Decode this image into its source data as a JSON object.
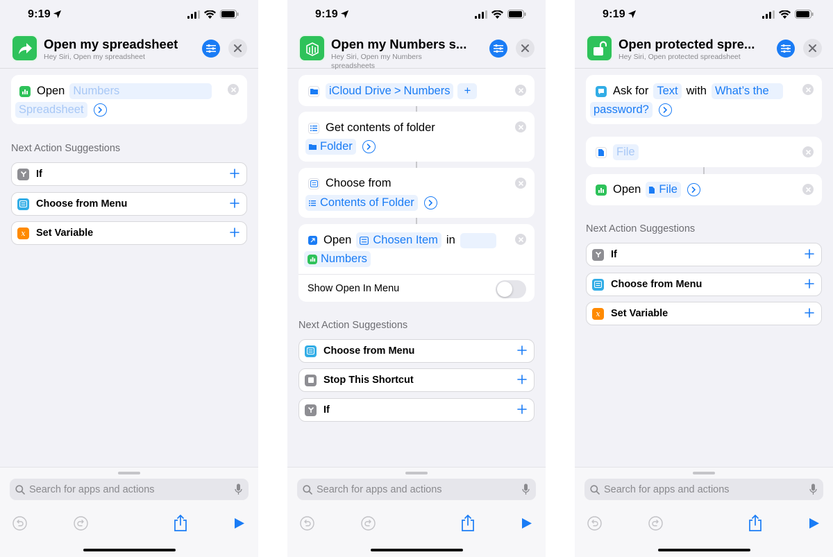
{
  "colors": {
    "accent": "#1a7cf5",
    "numbers_green": "#2ec25a",
    "background": "#f2f2f7"
  },
  "status": {
    "time": "9:19"
  },
  "bottom": {
    "search_placeholder": "Search for apps and actions"
  },
  "phones": [
    {
      "header": {
        "title": "Open my spreadsheet",
        "subtitle": "Hey Siri, Open my spreadsheet",
        "icon": "share-arrow-icon"
      },
      "action": {
        "verb": "Open",
        "token1": "Numbers",
        "token2": "Spreadsheet"
      },
      "suggestions_label": "Next Action Suggestions",
      "suggestions": [
        "If",
        "Choose from Menu",
        "Set Variable"
      ]
    },
    {
      "header": {
        "title": "Open my Numbers s...",
        "subtitle": "Hey Siri, Open my Numbers spreadsheets",
        "icon": "numbers-app-icon"
      },
      "a1": {
        "location": "iCloud Drive",
        "separator": ">",
        "folder": "Numbers",
        "add": "+"
      },
      "a2": {
        "label": "Get contents of folder",
        "token": "Folder"
      },
      "a3": {
        "label": "Choose from",
        "token": "Contents of Folder"
      },
      "a4": {
        "verb": "Open",
        "token": "Chosen Item",
        "in": "in",
        "app": "Numbers"
      },
      "a4_toggle": {
        "label": "Show Open In Menu",
        "on": false
      },
      "suggestions_label": "Next Action Suggestions",
      "suggestions": [
        "Choose from Menu",
        "Stop This Shortcut",
        "If"
      ]
    },
    {
      "header": {
        "title": "Open protected spre...",
        "subtitle": "Hey Siri, Open protected spreadsheet",
        "icon": "unlock-icon"
      },
      "a1": {
        "verb": "Ask for",
        "type": "Text",
        "with": "with",
        "prompt1": "What’s the",
        "prompt2": "password?"
      },
      "a2": {
        "token": "File"
      },
      "a3": {
        "verb": "Open",
        "token": "File"
      },
      "suggestions_label": "Next Action Suggestions",
      "suggestions": [
        "If",
        "Choose from Menu",
        "Set Variable"
      ]
    }
  ]
}
